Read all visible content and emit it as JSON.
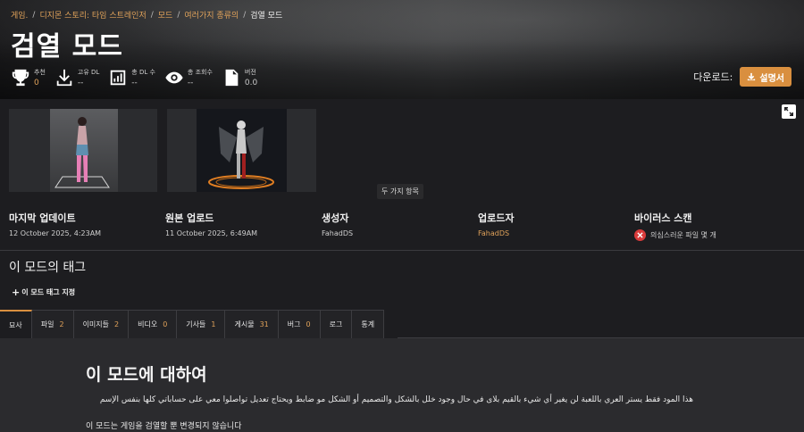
{
  "breadcrumb": {
    "items": [
      "게임.",
      "디지몬 스토리: 타임 스트레인저",
      "모드",
      "여러가지 종류의"
    ],
    "current": "검열 모드"
  },
  "title": "검열 모드",
  "stats": [
    {
      "icon": "trophy-icon",
      "label": "추천",
      "value": "0",
      "highlight": true
    },
    {
      "icon": "download-icon",
      "label": "고유 DL",
      "value": "--"
    },
    {
      "icon": "bar-chart-icon",
      "label": "총 DL 수",
      "value": "--"
    },
    {
      "icon": "eye-icon",
      "label": "총 조회수",
      "value": "--"
    },
    {
      "icon": "document-icon",
      "label": "버전",
      "value": "0.0"
    }
  ],
  "download": {
    "label": "다운로드:",
    "button": "설명서"
  },
  "gallery": {
    "tooltip": "두 가지 항목"
  },
  "meta": {
    "last_update": {
      "label": "마지막 업데이트",
      "value": "12 October 2025, 4:23AM"
    },
    "original_upload": {
      "label": "원본 업로드",
      "value": "11 October 2025, 6:49AM"
    },
    "creator": {
      "label": "생성자",
      "value": "FahadDS"
    },
    "uploader": {
      "label": "업로드자",
      "value": "FahadDS"
    },
    "virus_scan": {
      "label": "바이러스 스캔",
      "value": "의심스러운 파일 몇 개"
    }
  },
  "tags": {
    "title": "이 모드의 태그",
    "add_label": "이 모드 태그 지정"
  },
  "tabs": [
    {
      "label": "묘사",
      "count": null,
      "active": true
    },
    {
      "label": "파일",
      "count": "2"
    },
    {
      "label": "이미지들",
      "count": "2"
    },
    {
      "label": "비디오",
      "count": "0"
    },
    {
      "label": "기사들",
      "count": "1"
    },
    {
      "label": "게시물",
      "count": "31"
    },
    {
      "label": "버그",
      "count": "0"
    },
    {
      "label": "로그",
      "count": null
    },
    {
      "label": "통계",
      "count": null
    }
  ],
  "description": {
    "title": "이 모드에 대하여",
    "arabic_text": "هذا المود فقط يستر العري باللعبة لن يغير أي شيء بالقيم بلاى في حال وجود خلل بالشكل والتصميم أو الشكل مو ضابط ويحتاج تعديل تواصلوا معي على حساباتي كلها بنفس الإسم",
    "note": "이 모드는 게임을 검열할 뿐 변경되지 않습니다"
  },
  "colors": {
    "accent": "#d98f3f",
    "link": "#e0a25a",
    "danger": "#d93b3b"
  }
}
